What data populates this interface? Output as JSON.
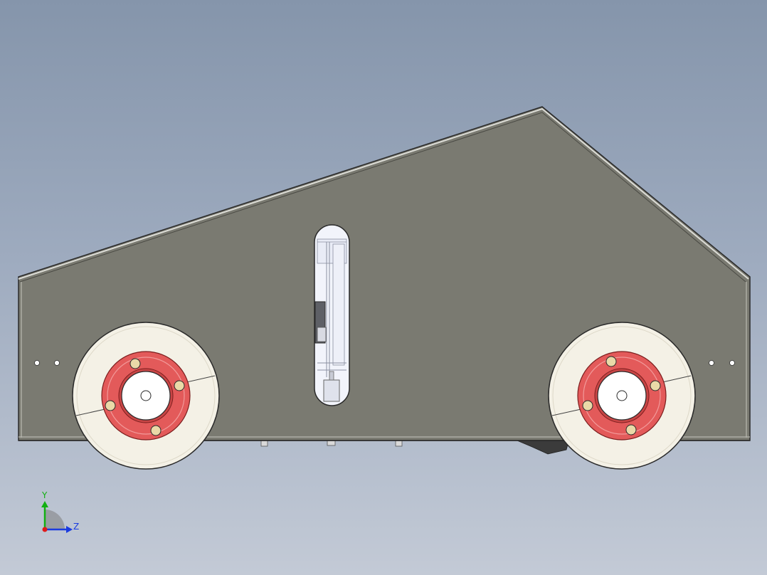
{
  "viewport": {
    "background_top": "#8595ab",
    "background_bottom": "#c3cad6"
  },
  "model": {
    "body_color": "#7a7a71",
    "tire_color": "#f4f1e6",
    "hub_color": "#e35a5a",
    "bolt_color": "#ead9a8",
    "edge_color": "#2a2a2a"
  },
  "triad": {
    "y_label": "Y",
    "z_label": "Z",
    "y_color": "#12b012",
    "z_color": "#1a3be0",
    "x_color": "#e01a1a"
  }
}
